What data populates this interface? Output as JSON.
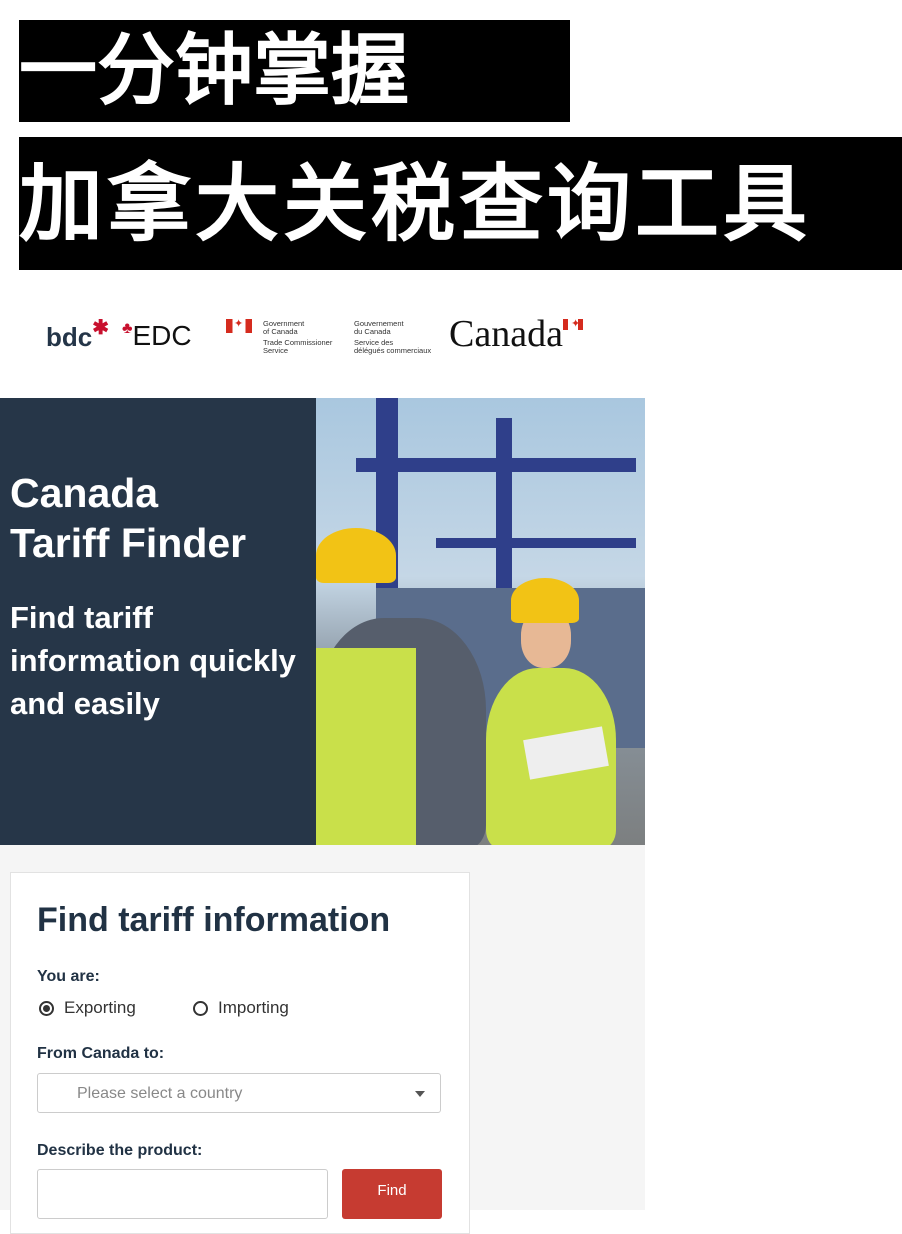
{
  "banner": {
    "line1": "一分钟掌握",
    "line2": "加拿大关税查询工具"
  },
  "logos": {
    "bdc": "bdc",
    "edc": "EDC",
    "tcs_en": [
      "Government",
      "of Canada",
      "Trade Commissioner",
      "Service"
    ],
    "tcs_fr": [
      "Gouvernement",
      "du Canada",
      "Service des",
      "délégués commerciaux"
    ],
    "wordmark": "Canada"
  },
  "hero": {
    "title_line1": "Canada",
    "title_line2": "Tariff Finder",
    "subtitle": "Find tariff information quickly and easily"
  },
  "form": {
    "title": "Find tariff information",
    "you_are_label": "You are:",
    "options": [
      {
        "label": "Exporting",
        "selected": true
      },
      {
        "label": "Importing",
        "selected": false
      }
    ],
    "country_label": "From Canada to:",
    "country_placeholder": "Please select a country",
    "product_label": "Describe the product:",
    "product_value": "",
    "find_label": "Find"
  },
  "colors": {
    "hero_bg": "#263648",
    "accent": "#c63b31",
    "heading": "#213244"
  }
}
